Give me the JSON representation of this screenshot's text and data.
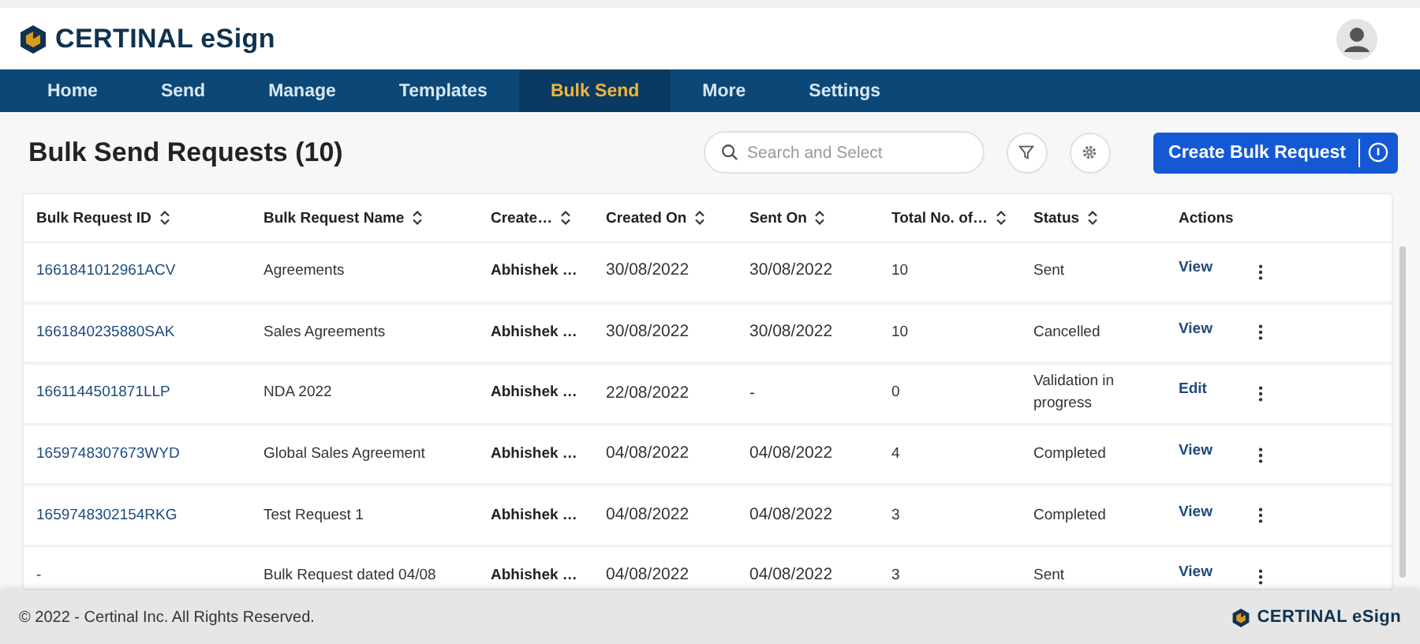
{
  "brand": {
    "logo_text": "CERTINAL eSign"
  },
  "nav": [
    {
      "label": "Home",
      "selected": false
    },
    {
      "label": "Send",
      "selected": false
    },
    {
      "label": "Manage",
      "selected": false
    },
    {
      "label": "Templates",
      "selected": false
    },
    {
      "label": "Bulk Send",
      "selected": true
    },
    {
      "label": "More",
      "selected": false
    },
    {
      "label": "Settings",
      "selected": false
    }
  ],
  "page_title": "Bulk Send Requests (10)",
  "search": {
    "placeholder": "Search and Select"
  },
  "create_button": {
    "label": "Create Bulk Request"
  },
  "table": {
    "columns": [
      {
        "label": "Bulk Request ID",
        "sortable": true
      },
      {
        "label": "Bulk Request Name",
        "sortable": true
      },
      {
        "label": "Create…",
        "sortable": true
      },
      {
        "label": "Created On",
        "sortable": true
      },
      {
        "label": "Sent On",
        "sortable": true
      },
      {
        "label": "Total No. of…",
        "sortable": true
      },
      {
        "label": "Status",
        "sortable": true
      },
      {
        "label": "Actions",
        "sortable": false
      }
    ],
    "rows": [
      {
        "id": "1661841012961ACV",
        "name": "Agreements",
        "creator": "Abhishek …",
        "created_on": "30/08/2022",
        "sent_on": "30/08/2022",
        "total": "10",
        "status": "Sent",
        "action": "View"
      },
      {
        "id": "1661840235880SAK",
        "name": "Sales Agreements",
        "creator": "Abhishek …",
        "created_on": "30/08/2022",
        "sent_on": "30/08/2022",
        "total": "10",
        "status": "Cancelled",
        "action": "View"
      },
      {
        "id": "1661144501871LLP",
        "name": "NDA 2022",
        "creator": "Abhishek …",
        "created_on": "22/08/2022",
        "sent_on": "-",
        "total": "0",
        "status": "Validation in progress",
        "action": "Edit"
      },
      {
        "id": "1659748307673WYD",
        "name": "Global Sales Agreement",
        "creator": "Abhishek …",
        "created_on": "04/08/2022",
        "sent_on": "04/08/2022",
        "total": "4",
        "status": "Completed",
        "action": "View"
      },
      {
        "id": "1659748302154RKG",
        "name": "Test Request 1",
        "creator": "Abhishek …",
        "created_on": "04/08/2022",
        "sent_on": "04/08/2022",
        "total": "3",
        "status": "Completed",
        "action": "View"
      },
      {
        "id": "-",
        "name": "Bulk Request dated 04/08",
        "creator": "Abhishek …",
        "created_on": "04/08/2022",
        "sent_on": "04/08/2022",
        "total": "3",
        "status": "Sent",
        "action": "View"
      }
    ]
  },
  "footer": {
    "copyright": "© 2022 - Certinal Inc. All Rights Reserved.",
    "logo_text": "CERTINAL eSign"
  }
}
